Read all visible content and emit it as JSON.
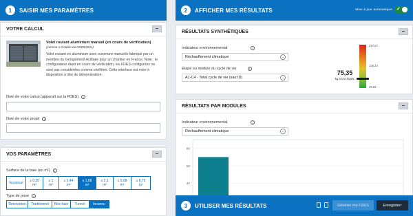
{
  "step1": {
    "num": "1",
    "title": "SAISIR MES PARAMÈTRES"
  },
  "step2": {
    "num": "2",
    "title": "AFFICHER MES RÉSULTATS",
    "auto_update_label": "Mise à jour automatique"
  },
  "step3": {
    "num": "3",
    "title": "UTILISER MES RÉSULTATS",
    "generate_label": "Générer ma FDES",
    "save_label": "Enregistrer"
  },
  "calc": {
    "section_title": "VOTRE CALCUL",
    "product_title": "Volet roulant aluminium manuel (en cours de vérification)",
    "product_sub": "(version 1.0 datée du 03/09/2021)",
    "description": "Volet roulant en aluminium avec ouverture manuelle fabriqué par un membre du Groupement Actibaie pour un chantier en France. Note : le configurateur étant en cours de vérification, les FDES configurées ne sont pas considérées comme vérifiées. Cette interface est mise à disposition à titre de démonstration.",
    "calc_name_label": "Nom de votre calcul (apparaît sur la FDES)",
    "calc_name_value": "",
    "project_name_label": "Nom de votre projet",
    "project_name_value": ""
  },
  "params": {
    "section_title": "VOS PARAMÈTRES",
    "bay_label": "Surface de la baie (en m²)",
    "bay_options": [
      {
        "l1": "Inconnue",
        "l2": ""
      },
      {
        "l1": "≤ 0,35",
        "l2": "m²"
      },
      {
        "l1": "≤ 1",
        "l2": "m²"
      },
      {
        "l1": "≤ 1,44",
        "l2": "m²"
      },
      {
        "l1": "≤ 1,68",
        "l2": "m²"
      },
      {
        "l1": "≤ 2,1",
        "l2": "m²"
      },
      {
        "l1": "≤ 5,08",
        "l2": "m²"
      },
      {
        "l1": "≤ 8,75",
        "l2": "m²"
      }
    ],
    "bay_selected_index": 4,
    "pose_label": "Type de pose",
    "pose_options": [
      "Rénovation",
      "Traditionnel",
      "Bloc baie",
      "Tunnel",
      "Inconnu"
    ],
    "pose_selected_index": 4
  },
  "synth": {
    "section_title": "RÉSULTATS SYNTHÉTIQUES",
    "indicator_label": "Indicateur environnemental",
    "indicator_value": "Réchauffement climatique",
    "stage_label": "Étape ou module du cycle de vie",
    "stage_value": "A1-C4 - Total cycle de vie (sauf D)",
    "value": "75,35",
    "unit": "kg CO2 équiv.",
    "gauge_top": "237,57",
    "gauge_mid": "126,24",
    "gauge_bottom": "29,63",
    "gauge_fraction": 0.22
  },
  "modules": {
    "section_title": "RÉSULTATS PAR MODULES",
    "indicator_label": "Indicateur environnemental",
    "indicator_value": "Réchauffement climatique",
    "y_ticks": [
      "80",
      "60",
      "40",
      "20"
    ],
    "bar_value": 70,
    "y_max": 90
  },
  "colors": {
    "primary": "#0b72c1",
    "toggle": "#1e8a3a",
    "bar": "#0e7f8e",
    "dark_btn": "#1d2b3a"
  }
}
